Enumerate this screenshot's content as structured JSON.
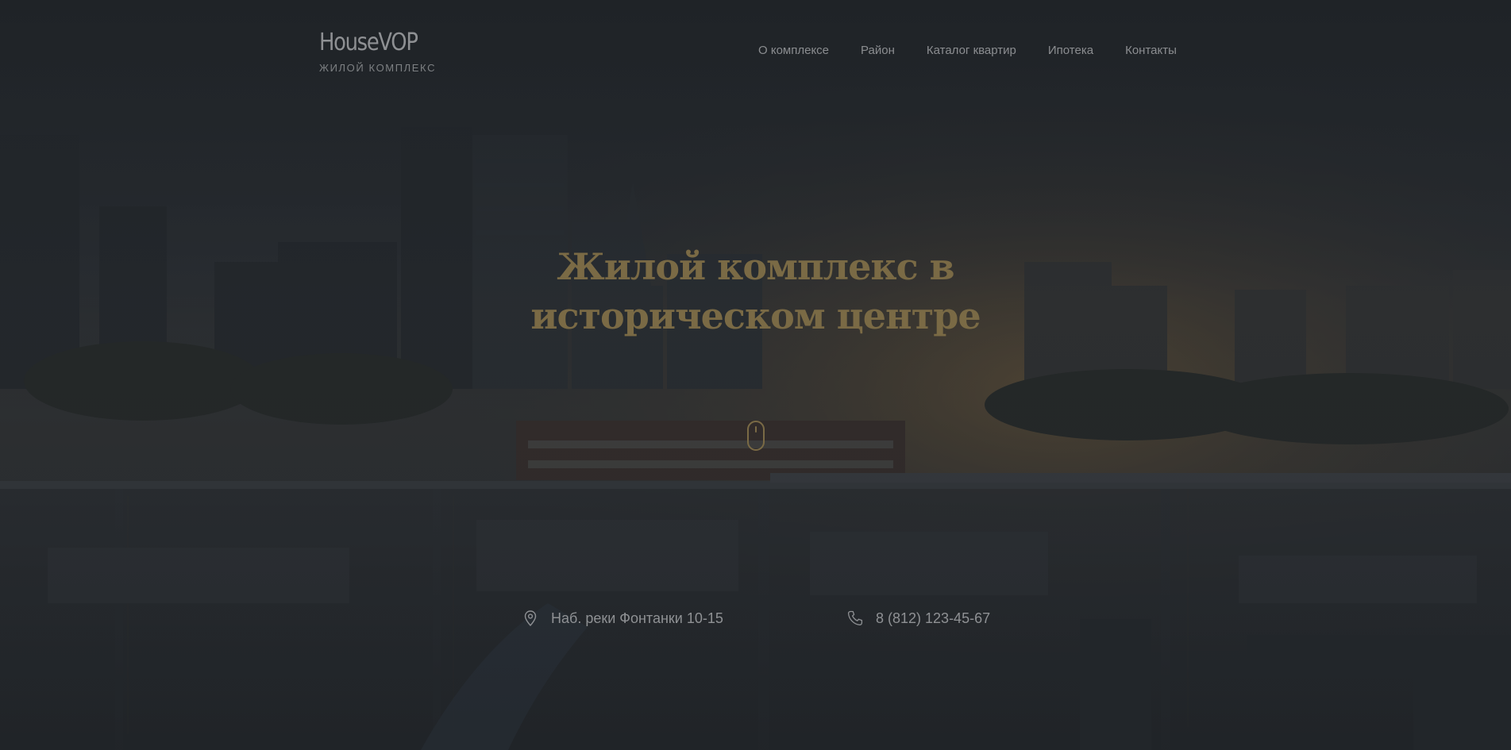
{
  "logo": {
    "title": "HouseVOP",
    "subtitle": "ЖИЛОЙ КОМПЛЕКС"
  },
  "nav": {
    "items": [
      {
        "label": "О комплексе"
      },
      {
        "label": "Район"
      },
      {
        "label": "Каталог квартир"
      },
      {
        "label": "Ипотека"
      },
      {
        "label": "Контакты"
      }
    ]
  },
  "hero": {
    "title_line1": "Жилой комплекс в",
    "title_line2": "историческом центре",
    "scroll_icon": "mouse-scroll-icon",
    "accent_color": "#7a6a45"
  },
  "contacts": {
    "address": {
      "icon": "location-pin-icon",
      "text": "Наб. реки Фонтанки 10-15"
    },
    "phone": {
      "icon": "phone-icon",
      "text": "8 (812) 123-45-67"
    }
  },
  "background": {
    "description_color_top": "#1f2226",
    "glow_color": "#b08a4a"
  }
}
